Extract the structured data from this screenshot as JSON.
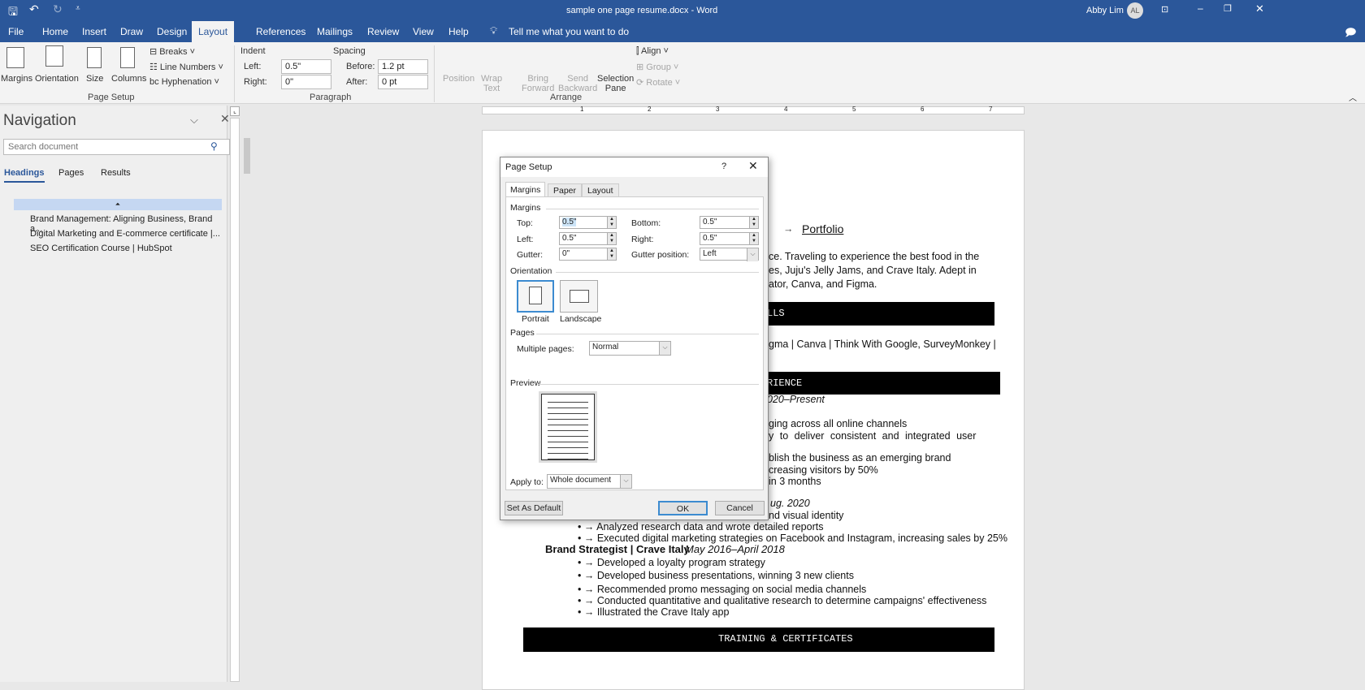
{
  "titlebar": {
    "title": "sample one page resume.docx  -  Word",
    "user": "Abby Lim",
    "initials": "AL"
  },
  "tabs": [
    "File",
    "Home",
    "Insert",
    "Draw",
    "Design",
    "Layout",
    "References",
    "Mailings",
    "Review",
    "View",
    "Help"
  ],
  "tell_me": "Tell me what you want to do",
  "ribbon": {
    "page_setup": {
      "margins": "Margins",
      "orientation": "Orientation",
      "size": "Size",
      "columns": "Columns",
      "breaks": "Breaks",
      "line_numbers": "Line Numbers",
      "hyphenation": "Hyphenation",
      "label": "Page Setup"
    },
    "paragraph": {
      "indent": "Indent",
      "spacing": "Spacing",
      "left_label": "Left:",
      "left_value": "0.5\"",
      "right_label": "Right:",
      "right_value": "0\"",
      "before_label": "Before:",
      "before_value": "1.2 pt",
      "after_label": "After:",
      "after_value": "0 pt",
      "label": "Paragraph"
    },
    "arrange": {
      "position": "Position",
      "wrap1": "Wrap",
      "wrap2": "Text",
      "bring1": "Bring",
      "bring2": "Forward",
      "send1": "Send",
      "send2": "Backward",
      "sel1": "Selection",
      "sel2": "Pane",
      "align": "Align",
      "group": "Group",
      "rotate": "Rotate",
      "label": "Arrange"
    }
  },
  "navigation": {
    "title": "Navigation",
    "search_placeholder": "Search document",
    "tabs": [
      "Headings",
      "Pages",
      "Results"
    ],
    "headings": [
      "Brand Management: Aligning Business, Brand a...",
      "Digital Marketing and E-commerce certificate |...",
      "SEO Certification Course | HubSpot"
    ]
  },
  "ruler": [
    "1",
    "2",
    "3",
    "4",
    "5",
    "6",
    "7"
  ],
  "document": {
    "portfolio": "Portfolio",
    "summary": [
      "ce. Traveling to experience the best food in the",
      "es, Juju's Jelly Jams, and Crave Italy. Adept in",
      "ator, Canva, and Figma."
    ],
    "skills_bar": "LLS",
    "skills": "gma | Canva | Think With Google, SurveyMonkey |",
    "experience_bar": "RIENCE",
    "date1": "020–Present",
    "lines1": [
      "ging across all online channels",
      "y  to  deliver  consistent  and  integrated  user",
      "blish the business as an emerging brand",
      "creasing visitors by 50%",
      "in 3 months"
    ],
    "date2": "ug. 2020",
    "lines2": [
      "nd visual identity",
      "• → Analyzed research data and wrote detailed reports",
      "• → Executed digital marketing strategies on Facebook and Instagram, increasing sales by 25%"
    ],
    "job3_title": "Brand Strategist | Crave Italy",
    "job3_date": "May 2016–April 2018",
    "job3_bullets": [
      "• → Developed a loyalty program strategy",
      "• → Developed business presentations, winning 3 new clients",
      "• → Recommended promo messaging on social media channels",
      "• → Conducted quantitative and qualitative research to determine campaigns' effectiveness",
      "• → Illustrated the Crave Italy app"
    ],
    "training_bar": "TRAINING   & CERTIFICATES"
  },
  "dialog": {
    "title": "Page Setup",
    "help": "?",
    "tabs": [
      "Margins",
      "Paper",
      "Layout"
    ],
    "margins_section": "Margins",
    "top_label": "Top:",
    "top": "0.5\"",
    "bottom_label": "Bottom:",
    "bottom": "0.5\"",
    "left_label": "Left:",
    "left": "0.5\"",
    "right_label": "Right:",
    "right": "0.5\"",
    "gutter_label": "Gutter:",
    "gutter": "0\"",
    "gutter_pos_label": "Gutter position:",
    "gutter_pos": "Left",
    "orientation_section": "Orientation",
    "portrait": "Portrait",
    "landscape": "Landscape",
    "pages_section": "Pages",
    "multiple_label": "Multiple pages:",
    "multiple": "Normal",
    "preview_section": "Preview",
    "apply_label": "Apply to:",
    "apply": "Whole document",
    "set_default": "Set As Default",
    "ok": "OK",
    "cancel": "Cancel"
  }
}
